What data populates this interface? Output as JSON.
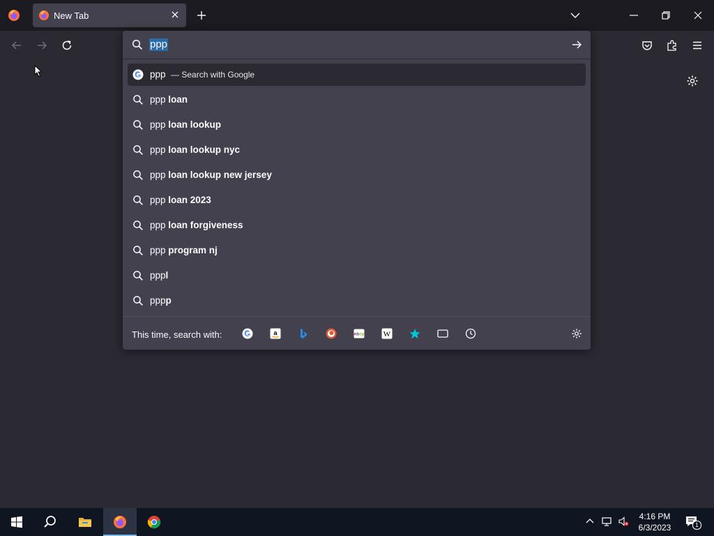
{
  "browser": {
    "tab": {
      "title": "New Tab"
    }
  },
  "urlbar": {
    "query": "ppp",
    "results": [
      {
        "prefix": "ppp",
        "bold": "",
        "suffix": "— Search with Google",
        "icon": "google-g-icon",
        "selected": true
      },
      {
        "prefix": "ppp",
        "bold": " loan",
        "icon": "search-icon"
      },
      {
        "prefix": "ppp",
        "bold": " loan lookup",
        "icon": "search-icon"
      },
      {
        "prefix": "ppp",
        "bold": " loan lookup nyc",
        "icon": "search-icon"
      },
      {
        "prefix": "ppp",
        "bold": " loan lookup new jersey",
        "icon": "search-icon"
      },
      {
        "prefix": "ppp",
        "bold": " loan 2023",
        "icon": "search-icon"
      },
      {
        "prefix": "ppp",
        "bold": " loan forgiveness",
        "icon": "search-icon"
      },
      {
        "prefix": "ppp",
        "bold": " program nj",
        "icon": "search-icon"
      },
      {
        "prefix": "ppp",
        "bold": "l",
        "icon": "search-icon"
      },
      {
        "prefix": "ppp",
        "bold": "p",
        "icon": "search-icon"
      }
    ],
    "footer_label": "This time, search with:",
    "engines": [
      "google",
      "amazon",
      "bing",
      "duckduckgo",
      "ebay",
      "wikipedia",
      "bookmarks",
      "tabs",
      "history"
    ]
  },
  "taskbar": {
    "time": "4:16 PM",
    "date": "6/3/2023",
    "notifications": "1"
  },
  "colors": {
    "accent": "#2b6ba8",
    "panel": "#42414d",
    "chrome": "#1c1b22"
  }
}
